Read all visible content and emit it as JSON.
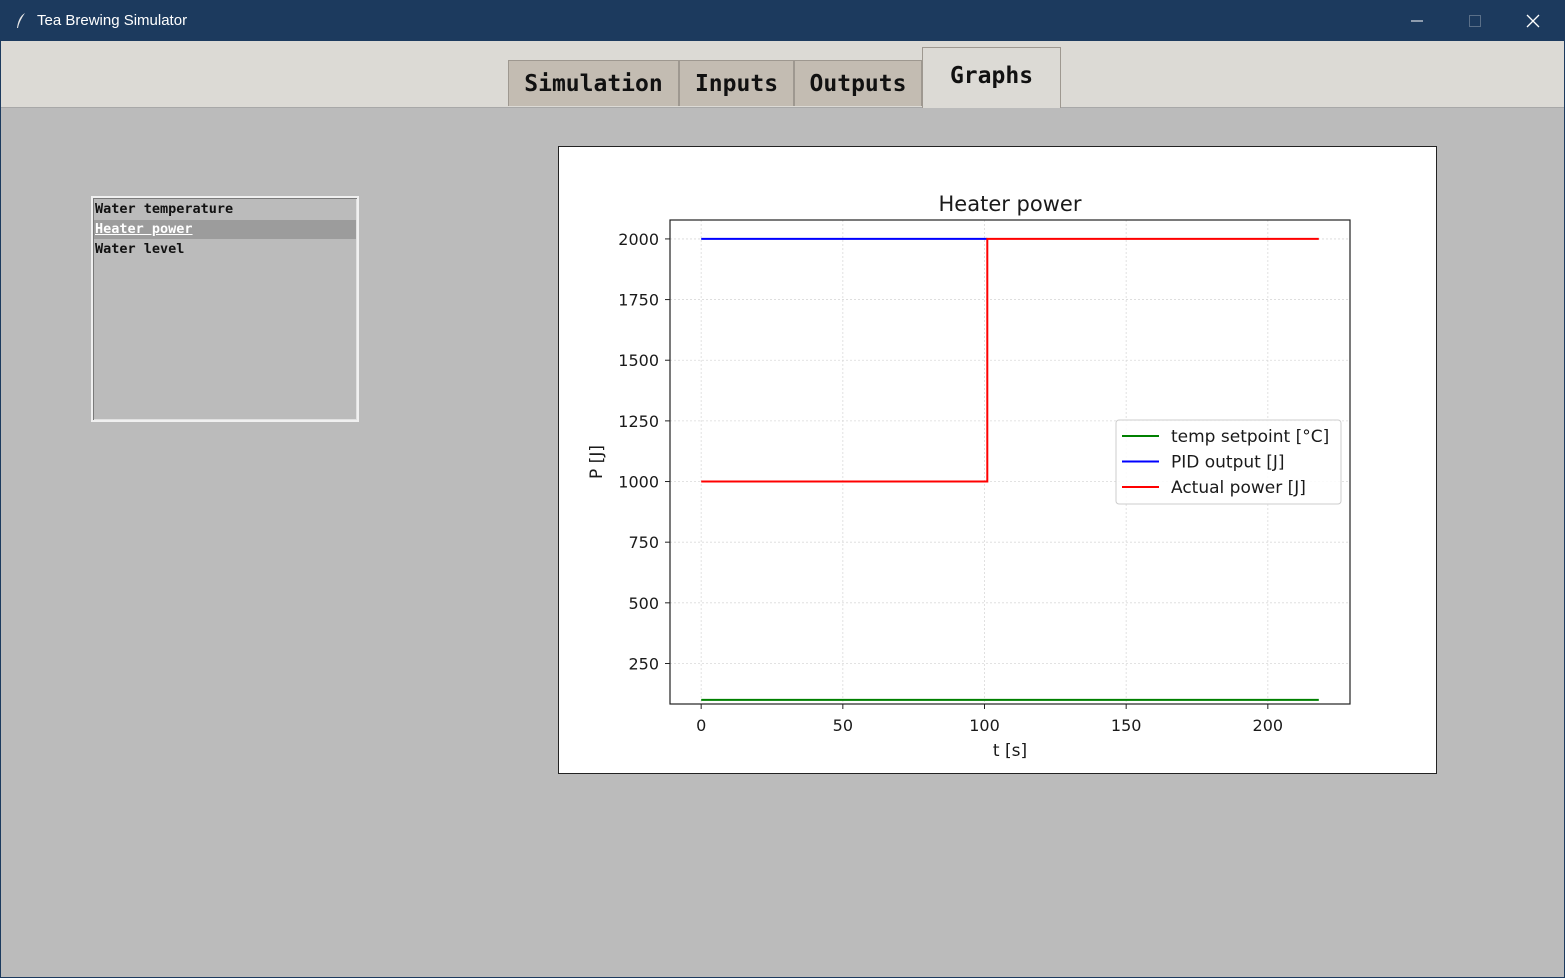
{
  "window": {
    "title": "Tea Brewing Simulator"
  },
  "tabs": [
    {
      "label": "Simulation",
      "active": false
    },
    {
      "label": "Inputs",
      "active": false
    },
    {
      "label": "Outputs",
      "active": false
    },
    {
      "label": "Graphs",
      "active": true
    }
  ],
  "graph_list": {
    "items": [
      "Water temperature",
      "Heater power",
      "Water level"
    ],
    "selected_index": 1
  },
  "chart_data": {
    "type": "line",
    "title": "Heater power",
    "xlabel": "t [s]",
    "ylabel": "P [J]",
    "xlim": [
      -11,
      229
    ],
    "ylim": [
      83,
      2078
    ],
    "xticks": [
      0,
      50,
      100,
      150,
      200
    ],
    "yticks": [
      250,
      500,
      750,
      1000,
      1250,
      1500,
      1750,
      2000
    ],
    "grid": true,
    "legend_position": "center-right",
    "series": [
      {
        "name": "temp setpoint [°C]",
        "color": "#008000",
        "points": [
          [
            0,
            100
          ],
          [
            218,
            100
          ]
        ]
      },
      {
        "name": "PID output [J]",
        "color": "#0000ff",
        "points": [
          [
            0,
            2000
          ],
          [
            101,
            2000
          ]
        ]
      },
      {
        "name": "Actual power [J]",
        "color": "#ff0000",
        "points": [
          [
            0,
            1000
          ],
          [
            101,
            1000
          ],
          [
            101,
            2000
          ],
          [
            218,
            2000
          ]
        ]
      }
    ]
  }
}
